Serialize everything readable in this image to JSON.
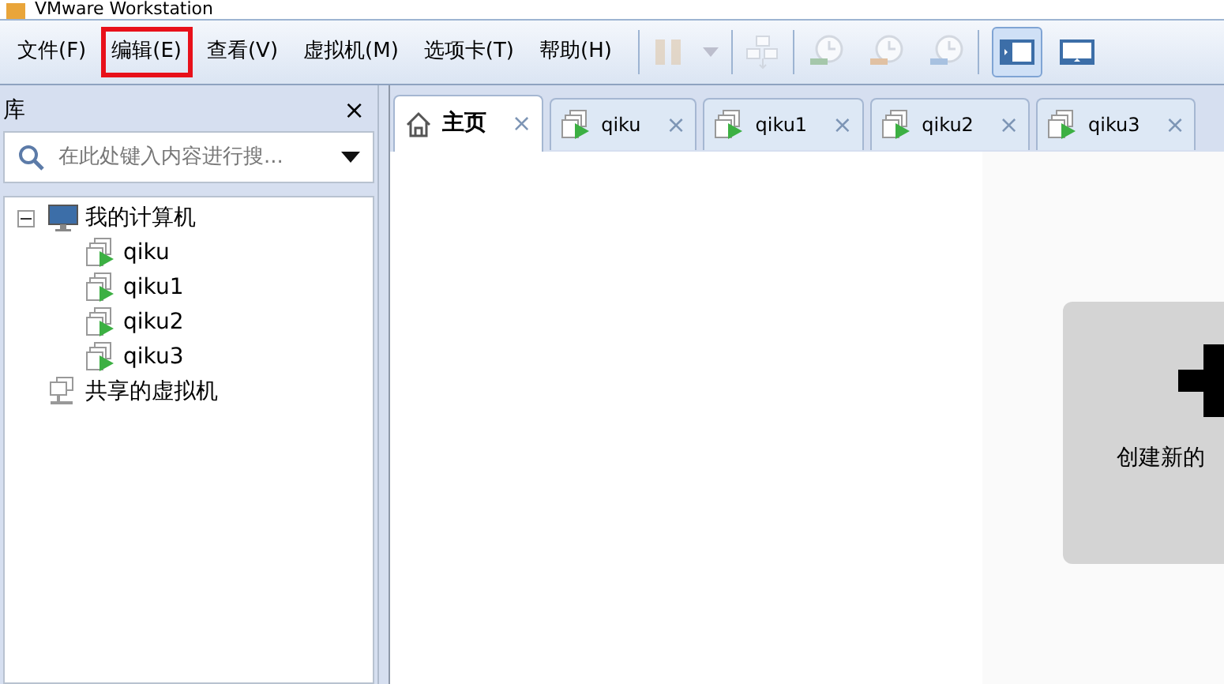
{
  "window": {
    "title": "VMware Workstation"
  },
  "menu": [
    {
      "label": "文件(F)",
      "highlighted": false
    },
    {
      "label": "编辑(E)",
      "highlighted": true
    },
    {
      "label": "查看(V)",
      "highlighted": false
    },
    {
      "label": "虚拟机(M)",
      "highlighted": false
    },
    {
      "label": "选项卡(T)",
      "highlighted": false
    },
    {
      "label": "帮助(H)",
      "highlighted": false
    }
  ],
  "toolbar": [
    {
      "kind": "pause",
      "disabled": true
    },
    {
      "kind": "dropdown",
      "disabled": true
    },
    {
      "kind": "network",
      "disabled": true
    },
    {
      "kind": "snapshot-add",
      "disabled": true
    },
    {
      "kind": "snapshot-revert",
      "disabled": true
    },
    {
      "kind": "snapshot-manage",
      "disabled": true
    }
  ],
  "view_buttons": [
    {
      "kind": "sidebar",
      "selected": true
    },
    {
      "kind": "console",
      "selected": false
    }
  ],
  "library": {
    "title": "库",
    "close": "×",
    "search": {
      "placeholder": "在此处键入内容进行搜..."
    },
    "tree": [
      {
        "label": "我的计算机",
        "kind": "computer",
        "expanded": true,
        "children": [
          {
            "label": "qiku",
            "kind": "vm"
          },
          {
            "label": "qiku1",
            "kind": "vm"
          },
          {
            "label": "qiku2",
            "kind": "vm"
          },
          {
            "label": "qiku3",
            "kind": "vm"
          }
        ]
      },
      {
        "label": "共享的虚拟机",
        "kind": "shared"
      }
    ]
  },
  "tabs": [
    {
      "label": "主页",
      "kind": "home",
      "selected": true,
      "close": "×"
    },
    {
      "label": "qiku",
      "kind": "vm",
      "selected": false,
      "close": "×"
    },
    {
      "label": "qiku1",
      "kind": "vm",
      "selected": false,
      "close": "×"
    },
    {
      "label": "qiku2",
      "kind": "vm",
      "selected": false,
      "close": "×"
    },
    {
      "label": "qiku3",
      "kind": "vm",
      "selected": false,
      "close": "×"
    }
  ],
  "home": {
    "card": {
      "label": "创建新的"
    }
  }
}
